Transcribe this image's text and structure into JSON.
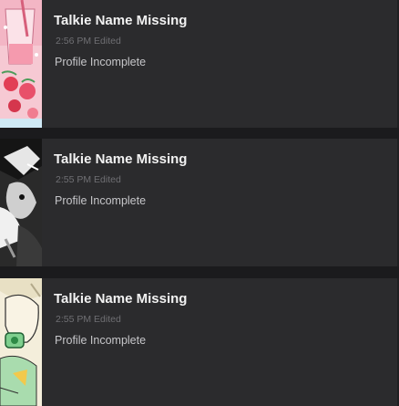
{
  "talkies": [
    {
      "name": "Talkie Name Missing",
      "time": "2:56 PM Edited",
      "status": "Profile Incomplete",
      "thumbnail_icon": "strawberry-drink-icon",
      "accent": "#e9a3b4"
    },
    {
      "name": "Talkie Name Missing",
      "time": "2:55 PM Edited",
      "status": "Profile Incomplete",
      "thumbnail_icon": "monochrome-character-icon",
      "accent": "#8a8a8a"
    },
    {
      "name": "Talkie Name Missing",
      "time": "2:55 PM Edited",
      "status": "Profile Incomplete",
      "thumbnail_icon": "green-character-icon",
      "accent": "#8fcf9a"
    }
  ]
}
